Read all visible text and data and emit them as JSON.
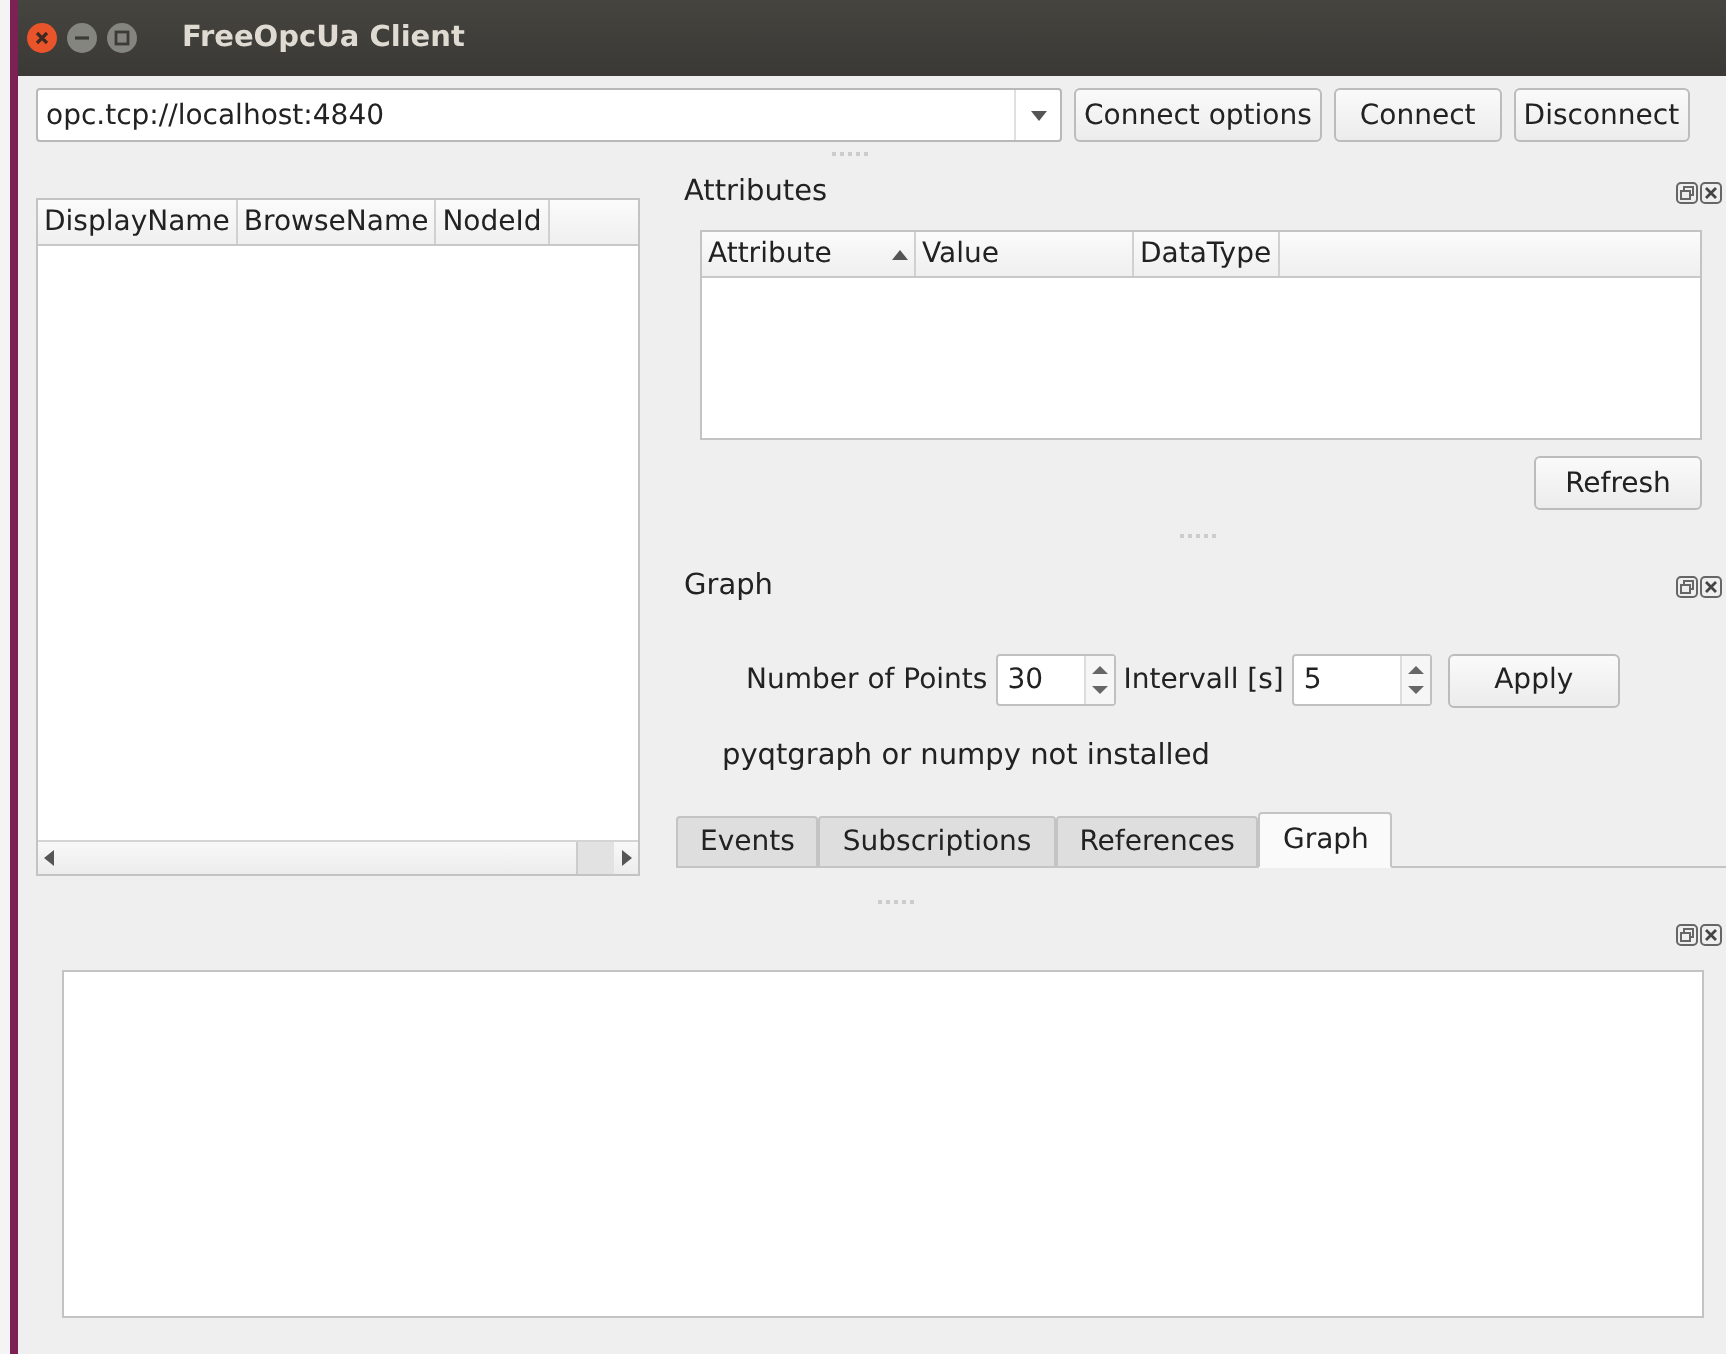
{
  "window": {
    "title": "FreeOpcUa Client"
  },
  "toolbar": {
    "address": "opc.tcp://localhost:4840",
    "buttons": [
      "Connect options",
      "Connect",
      "Disconnect"
    ]
  },
  "tree": {
    "columns": [
      "DisplayName",
      "BrowseName",
      "NodeId"
    ]
  },
  "attributes": {
    "title": "Attributes",
    "columns": [
      {
        "label": "Attribute",
        "sorted": true
      },
      {
        "label": "Value",
        "sorted": false
      },
      {
        "label": "DataType",
        "sorted": false
      }
    ],
    "refresh_button": "Refresh"
  },
  "graph": {
    "title": "Graph",
    "points_label": "Number of Points",
    "points_value": "30",
    "interval_label": "Intervall [s]",
    "interval_value": "5",
    "apply_button": "Apply",
    "message": "pyqtgraph or numpy not installed"
  },
  "tabs": [
    {
      "label": "Events",
      "selected": false
    },
    {
      "label": "Subscriptions",
      "selected": false
    },
    {
      "label": "References",
      "selected": false
    },
    {
      "label": "Graph",
      "selected": true
    }
  ]
}
